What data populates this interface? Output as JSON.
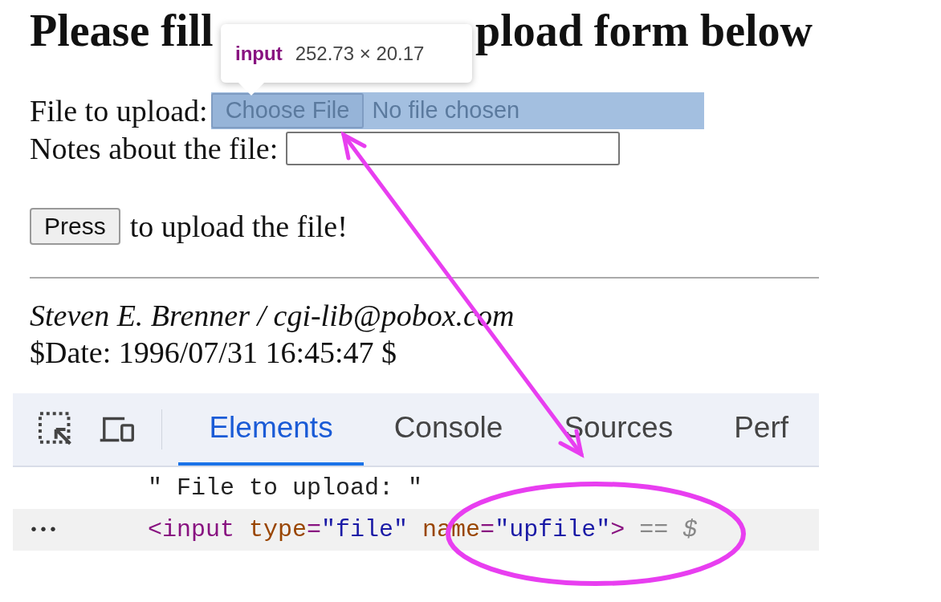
{
  "heading": [
    "Please fill",
    "pload form below"
  ],
  "tooltip": {
    "tag": "input",
    "size": "252.73 × 20.17"
  },
  "form": {
    "file_label": "File to upload:",
    "file_button": "Choose File",
    "file_status": "No file chosen",
    "file_highlighted": true,
    "notes_label": "Notes about the file:",
    "submit_button": "Press",
    "submit_suffix": "to upload the file!"
  },
  "footer": {
    "author": "Steven E. Brenner / cgi-lib@pobox.com",
    "date": "$Date: 1996/07/31 16:45:47 $"
  },
  "devtools": {
    "tabs": [
      {
        "label": "Elements",
        "selected": true
      },
      {
        "label": "Console",
        "selected": false
      },
      {
        "label": "Sources",
        "selected": false
      },
      {
        "label": "Perf",
        "selected": false
      }
    ],
    "lines": [
      {
        "selected": false,
        "tokens": [
          {
            "kind": "text",
            "text": "\" File to upload: \""
          }
        ]
      },
      {
        "selected": true,
        "gutter": "•••",
        "tokens": [
          {
            "kind": "tag",
            "text": "<input"
          },
          {
            "kind": "attr",
            "text": " type"
          },
          {
            "kind": "tag",
            "text": "="
          },
          {
            "kind": "value",
            "text": "\"file\""
          },
          {
            "kind": "attr",
            "text": " name"
          },
          {
            "kind": "tag",
            "text": "="
          },
          {
            "kind": "value",
            "text": "\"upfile\""
          },
          {
            "kind": "tag",
            "text": ">"
          },
          {
            "kind": "ref",
            "text": " == $"
          }
        ]
      }
    ]
  }
}
